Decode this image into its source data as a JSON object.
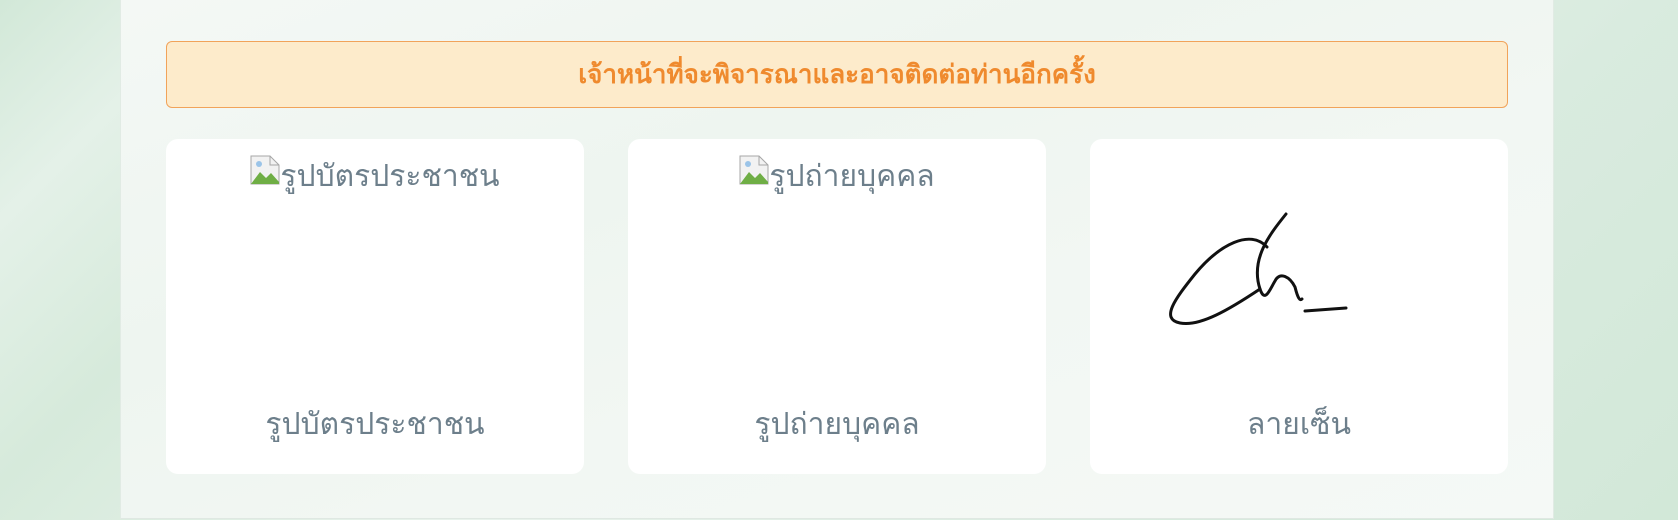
{
  "notice": {
    "text": "เจ้าหน้าที่จะพิจารณาและอาจติดต่อท่านอีกครั้ง"
  },
  "documents": [
    {
      "alt": "รูปบัตรประชาชน",
      "label": "รูปบัตรประชาชน",
      "icon": "broken-image-icon"
    },
    {
      "alt": "รูปถ่ายบุคคล",
      "label": "รูปถ่ายบุคคล",
      "icon": "broken-image-icon"
    },
    {
      "label": "ลายเซ็น"
    }
  ],
  "colors": {
    "notice_bg": "#fdebcb",
    "notice_border": "#f1a35a",
    "notice_text": "#ef8a2e",
    "label_text": "#6d7f8b"
  }
}
